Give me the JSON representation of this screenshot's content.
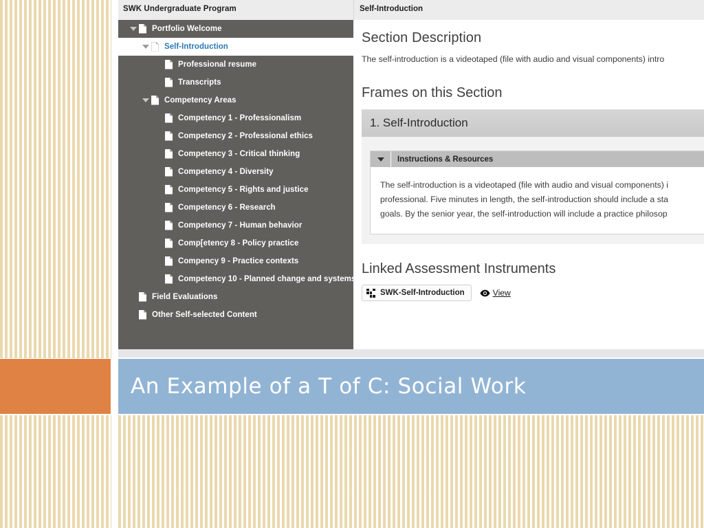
{
  "background": {
    "texture_color": "#e9d6aa",
    "accent_block_color": "#df8244",
    "banner_color": "#92b4d4"
  },
  "topbar": {
    "left_title": "SWK Undergraduate Program",
    "right_title": "Self-Introduction"
  },
  "tree": {
    "items": [
      {
        "label": "Portfolio Welcome",
        "indent": 0,
        "twisty": "open",
        "selected": false
      },
      {
        "label": "Self-Introduction",
        "indent": 1,
        "twisty": "open",
        "selected": true
      },
      {
        "label": "Professional resume",
        "indent": 2,
        "twisty": "none",
        "selected": false
      },
      {
        "label": "Transcripts",
        "indent": 2,
        "twisty": "none",
        "selected": false
      },
      {
        "label": "Competency Areas",
        "indent": 1,
        "twisty": "open",
        "selected": false
      },
      {
        "label": "Competency 1 - Professionalism",
        "indent": 2,
        "twisty": "none",
        "selected": false
      },
      {
        "label": "Competency 2 - Professional ethics",
        "indent": 2,
        "twisty": "none",
        "selected": false
      },
      {
        "label": "Competency 3 - Critical thinking",
        "indent": 2,
        "twisty": "none",
        "selected": false
      },
      {
        "label": "Competency 4 - Diversity",
        "indent": 2,
        "twisty": "none",
        "selected": false
      },
      {
        "label": "Competency 5 - Rights and justice",
        "indent": 2,
        "twisty": "none",
        "selected": false
      },
      {
        "label": "Competency 6 - Research",
        "indent": 2,
        "twisty": "none",
        "selected": false
      },
      {
        "label": "Competency 7 - Human behavior",
        "indent": 2,
        "twisty": "none",
        "selected": false
      },
      {
        "label": "Comp[etency 8 - Policy practice",
        "indent": 2,
        "twisty": "none",
        "selected": false
      },
      {
        "label": "Compency 9 - Practice contexts",
        "indent": 2,
        "twisty": "none",
        "selected": false
      },
      {
        "label": "Competency 10 - Planned change and systems",
        "indent": 2,
        "twisty": "none",
        "selected": false
      },
      {
        "label": "Field Evaluations",
        "indent": 0,
        "twisty": "none",
        "selected": false
      },
      {
        "label": "Other Self-selected Content",
        "indent": 0,
        "twisty": "none",
        "selected": false
      }
    ]
  },
  "content": {
    "section_description_heading": "Section Description",
    "section_description_text": "The self-introduction is a videotaped (file with audio and visual components) intro",
    "frames_heading": "Frames on this Section",
    "frame": {
      "title": "1. Self-Introduction",
      "accordion_title": "Instructions & Resources",
      "body_line_1": "The self-introduction is a videotaped (file with audio and visual components) i",
      "body_line_2": "professional. Five minutes in length, the self-introduction should include a sta",
      "body_line_3": "goals. By the senior year, the self-introduction will include a practice philosop"
    },
    "linked_heading": "Linked Assessment Instruments",
    "instrument_label": "SWK-Self-Introduction",
    "view_link_label": "View"
  },
  "slide": {
    "title": "An Example of a T of C: Social Work"
  }
}
